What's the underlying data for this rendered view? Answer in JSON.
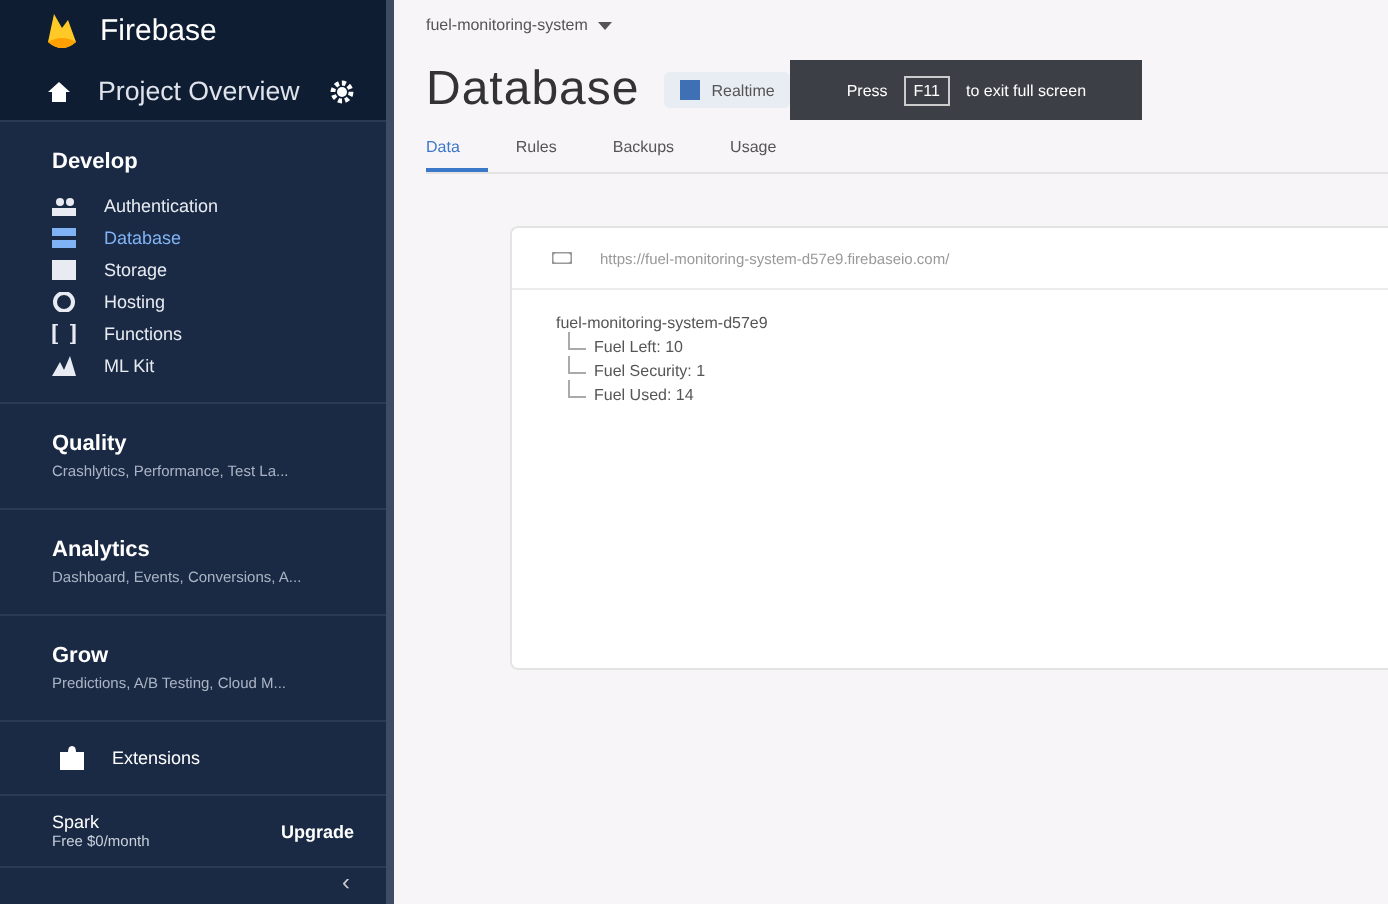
{
  "sidebar": {
    "brand": "Firebase",
    "project": "Project Overview",
    "develop": {
      "title": "Develop",
      "items": [
        {
          "label": "Authentication",
          "selected": false
        },
        {
          "label": "Database",
          "selected": true
        },
        {
          "label": "Storage",
          "selected": false
        },
        {
          "label": "Hosting",
          "selected": false
        },
        {
          "label": "Functions",
          "selected": false
        },
        {
          "label": "ML Kit",
          "selected": false
        }
      ]
    },
    "sections": [
      {
        "title": "Quality",
        "subtitle": "Crashlytics, Performance, Test La..."
      },
      {
        "title": "Analytics",
        "subtitle": "Dashboard, Events, Conversions, A..."
      },
      {
        "title": "Grow",
        "subtitle": "Predictions, A/B Testing, Cloud M..."
      }
    ],
    "extensions": "Extensions",
    "plan": {
      "name": "Spark",
      "price": "Free $0/month",
      "action": "Upgrade"
    },
    "collapse": "‹"
  },
  "breadcrumb": "fuel-monitoring-system",
  "title": "Database",
  "badge": "Realtime",
  "toast": {
    "before": "Press",
    "key": "F11",
    "after": "to exit full screen"
  },
  "tabs": [
    {
      "label": "Data",
      "selected": true
    },
    {
      "label": "Rules",
      "selected": false
    },
    {
      "label": "Backups",
      "selected": false
    },
    {
      "label": "Usage",
      "selected": false
    }
  ],
  "database": {
    "url": "https://fuel-monitoring-system-d57e9.firebaseio.com/",
    "root": "fuel-monitoring-system-d57e9",
    "children": [
      {
        "key": "Fuel Left:",
        "value": "10"
      },
      {
        "key": "Fuel Security:",
        "value": "1"
      },
      {
        "key": "Fuel Used:",
        "value": "14"
      }
    ]
  }
}
